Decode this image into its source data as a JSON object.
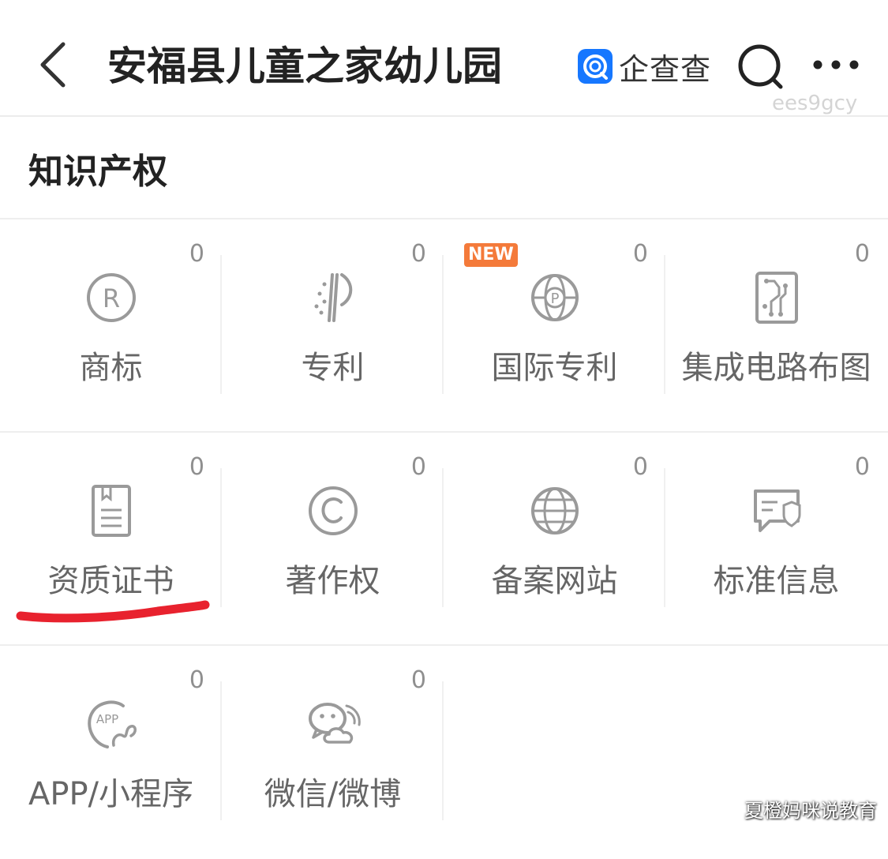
{
  "header": {
    "title": "安福县儿童之家幼儿园",
    "brand_name": "企查查",
    "watermark": "ees9gcy"
  },
  "section": {
    "title": "知识产权"
  },
  "badges": {
    "new": "NEW"
  },
  "grid": {
    "items": [
      {
        "label": "商标",
        "count": "0",
        "icon": "registered-trademark-icon"
      },
      {
        "label": "专利",
        "count": "0",
        "icon": "patent-icon"
      },
      {
        "label": "国际专利",
        "count": "0",
        "icon": "international-patent-icon",
        "badge": "NEW"
      },
      {
        "label": "集成电路布图",
        "count": "0",
        "icon": "circuit-layout-icon"
      },
      {
        "label": "资质证书",
        "count": "0",
        "icon": "certificate-icon"
      },
      {
        "label": "著作权",
        "count": "0",
        "icon": "copyright-icon"
      },
      {
        "label": "备案网站",
        "count": "0",
        "icon": "globe-icon"
      },
      {
        "label": "标准信息",
        "count": "0",
        "icon": "standard-info-icon"
      },
      {
        "label": "APP/小程序",
        "count": "0",
        "icon": "app-icon"
      },
      {
        "label": "微信/微博",
        "count": "0",
        "icon": "wechat-weibo-icon"
      }
    ]
  },
  "watermark_bottom": "夏橙妈咪说教育",
  "colors": {
    "brand_blue": "#1677ff",
    "new_badge": "#f47a3a",
    "annotation_red": "#e8222e",
    "icon_gray": "#9a9a9a",
    "label_gray": "#666666"
  }
}
